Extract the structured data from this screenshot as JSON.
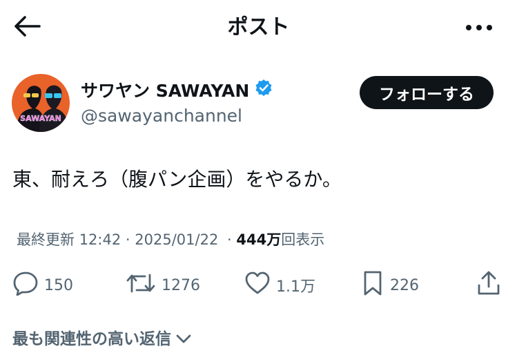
{
  "header": {
    "title": "ポスト",
    "back_icon": "arrow-left-icon",
    "more_icon": "more-horizontal-icon"
  },
  "author": {
    "display_name": "サワヤン SAWAYAN",
    "handle": "@sawayanchannel",
    "avatar_text": "SAWAYAN",
    "verified": true,
    "follow_label": "フォローする"
  },
  "post": {
    "text": "東、耐えろ（腹パン企画）をやるか。"
  },
  "meta": {
    "prefix": "最終更新",
    "time": "12:42",
    "sep1": "·",
    "date": "2025/01/22",
    "sep2": "·",
    "views_count": "444万",
    "views_label": "回表示"
  },
  "actions": {
    "replies": "150",
    "reposts": "1276",
    "likes": "1.1万",
    "bookmarks": "226"
  },
  "footer": {
    "related_label": "最も関連性の高い返信"
  },
  "colors": {
    "text": "#0f1419",
    "secondary": "#536471",
    "verified": "#1d9bf0",
    "avatar_bg": "#e9622a"
  }
}
